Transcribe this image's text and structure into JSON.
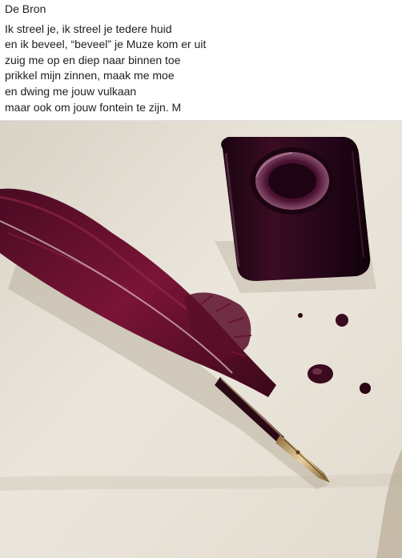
{
  "post": {
    "title": "De Bron",
    "lines": [
      "Ik streel je, ik streel je tedere huid",
      "en ik beveel, “beveel” je Muze kom er uit",
      "zuig me op en diep naar binnen toe",
      "prikkel mijn zinnen, maak me moe",
      "en dwing me jouw vulkaan",
      "maar ook om jouw fontein te zijn. M"
    ]
  },
  "image": {
    "subject": "quill-and-ink",
    "colors": {
      "paper": "#e7e1d6",
      "paper_shadow": "#cfc6b8",
      "feather": "#6e1030",
      "feather_dark": "#3e0a1c",
      "ink": "#2a0716",
      "nib": "#c9a86a"
    }
  }
}
